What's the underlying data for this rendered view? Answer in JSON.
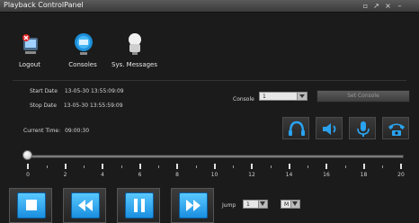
{
  "window": {
    "title": "Playback ControlPanel",
    "controls": [
      "restore-icon",
      "pin-icon",
      "close-icon",
      "minimize-icon"
    ]
  },
  "toolbar": {
    "items": [
      {
        "label": "Logout",
        "icon": "logout-icon"
      },
      {
        "label": "Consoles",
        "icon": "consoles-icon"
      },
      {
        "label": "Sys. Messages",
        "icon": "messages-icon"
      }
    ]
  },
  "info": {
    "start_label": "Start Date",
    "start_value": "13-05-30 13:55:09:09",
    "stop_label": "Stop Date",
    "stop_value": "13-05-30 13:55:59:09",
    "current_label": "Current Time",
    "current_value": "09:00:30"
  },
  "console": {
    "label": "Console",
    "selected": "1",
    "button_label": "Set Console"
  },
  "media_buttons": [
    "headphones-icon",
    "speaker-icon",
    "microphone-icon",
    "telephone-icon"
  ],
  "timeline": {
    "position": 0,
    "ticks": [
      "0",
      "2",
      "4",
      "6",
      "8",
      "10",
      "12",
      "14",
      "16",
      "18",
      "20"
    ]
  },
  "playback": {
    "buttons": [
      "stop-icon",
      "rewind-icon",
      "pause-icon",
      "fast-forward-icon"
    ],
    "jump_label": "Jump",
    "jump_value": "1",
    "unit_value": "M"
  },
  "colors": {
    "accent": "#2aa3f0",
    "background": "#1b1b1b"
  }
}
